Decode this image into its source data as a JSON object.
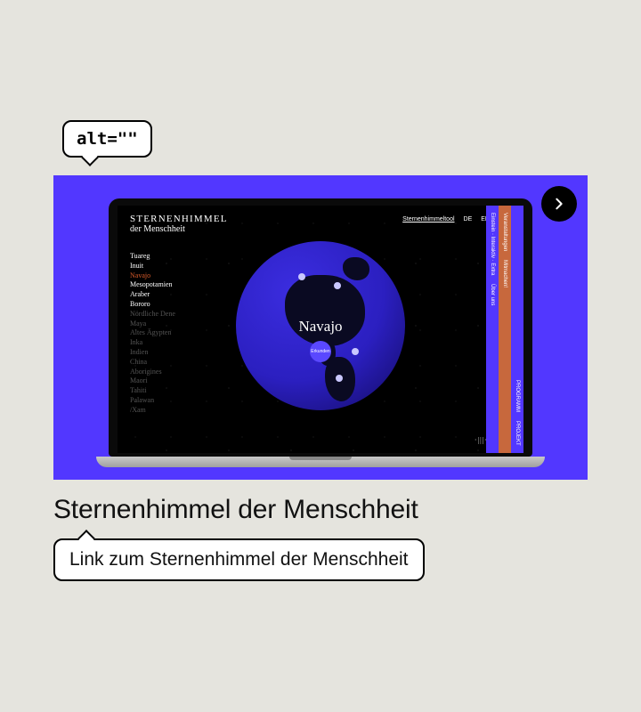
{
  "alt_badge": "alt=\"\"",
  "title": "Sternenhimmel der Menschheit",
  "link_text": "Link zum Sternenhimmel der Menschheit",
  "card": {
    "header_line1": "STERNENHIMMEL",
    "header_line2": "der Menschheit",
    "tool_link": "Sternenhimmeltool",
    "lang_de": "DE",
    "lang_en": "EN",
    "globe_label": "Navajo",
    "globe_button": "Erkunden",
    "cultures": [
      {
        "name": "Tuareg",
        "state": "normal"
      },
      {
        "name": "Inuit",
        "state": "normal"
      },
      {
        "name": "Navajo",
        "state": "active"
      },
      {
        "name": "Mesopotamien",
        "state": "normal"
      },
      {
        "name": "Araber",
        "state": "normal"
      },
      {
        "name": "Bororo",
        "state": "normal"
      },
      {
        "name": "Nördliche Dene",
        "state": "dim"
      },
      {
        "name": "Maya",
        "state": "dim"
      },
      {
        "name": "Altes Ägypten",
        "state": "dim"
      },
      {
        "name": "Inka",
        "state": "dim"
      },
      {
        "name": "Indien",
        "state": "dim"
      },
      {
        "name": "China",
        "state": "dim"
      },
      {
        "name": "Aborigines",
        "state": "dim"
      },
      {
        "name": "Maori",
        "state": "dim"
      },
      {
        "name": "Tahiti",
        "state": "dim"
      },
      {
        "name": "Palawan",
        "state": "dim"
      },
      {
        "name": "/Xam",
        "state": "dim"
      }
    ],
    "rail_orange_top": "Veranstaltungen",
    "rail_orange_bot": "Mitmachen!",
    "rail_purple_text": "Einstein · Interaktiv · Extra",
    "rail_purple_about": "Über uns",
    "rail_purple2_top": "PROGRAMM",
    "rail_purple2_bot": "PROJEKT"
  },
  "colors": {
    "accent": "#5237ff",
    "active": "#d85a2a",
    "rail_orange": "#c7683d"
  }
}
